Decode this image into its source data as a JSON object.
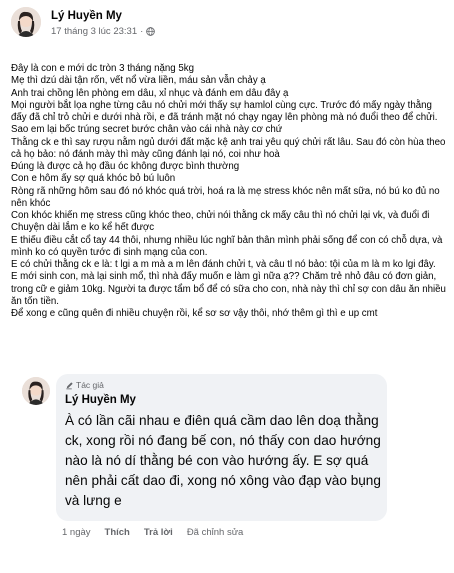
{
  "post": {
    "author": "Lý Huyền My",
    "timestamp": "17 tháng 3 lúc 23:31",
    "separator": "·",
    "privacy_icon": "globe-icon",
    "lines": [
      "Đây là con e mới dc tròn 3 tháng nặng 5kg",
      "Mẹ thì dzú dài tận rốn, vết nổ vừa liền, máu sản vẫn chảy ạ",
      "Anh trai chồng lên phòng em dâu, xỉ nhục và đánh em dâu đây ạ",
      "Mọi người bắt lọa nghe từng câu nó chửi mới thấy sự hamlol cùng cực. Trước đó mấy ngày thằng đấy đã chỉ trỏ chửi e dưới nhà rồi, e đã tránh mặt nó chạy ngay lên phòng mà nó đuổi theo để chửi.",
      "Sao em lại bốc trúng secret bước chân vào cái nhà này cơ chứ",
      "Thằng ck e thì say rượu nằm ngủ dưới đất mặc kệ anh trai yêu quý chửi rất lâu. Sau đó còn hùa theo cả họ bảo: nó đánh mày thì mày cũng đánh lại nó, coi như hoà",
      "Đúng là được cả họ đầu óc không được bình thường",
      "Con e hôm ấy sợ quá khóc bỏ bú luôn",
      "Ròng rã những hôm sau đó nó khóc quá trời, hoá ra là mẹ stress khóc nên mất sữa, nó bú ko đủ no nên khóc",
      "Con khóc khiến mẹ stress cũng khóc theo, chửi nói thằng ck mấy câu thì nó chửi lại vk, và đuổi đi Chuyện dài lắm e ko kể hết được",
      "E thiếu điều cắt cổ tay 44 thôi, nhưng nhiều lúc nghĩ bản thân mình phải sống để con có chỗ dựa, và mình ko có quyền tước đi sinh mạng của con.",
      "E có chửi thằng ck e là: t lgi a m mà a m lên đánh chửi t, và câu tl nó bảo: tội của m là m ko lgi đây.",
      "E mới sinh con, mà lại sinh mổ, thì nhà đấy muốn e làm gì nữa ạ?? Chăm trẻ nhỏ đâu có đơn giản, trong cữ e giảm 10kg. Người ta được tẩm bổ để có sữa cho con, nhà này thì chỉ sợ con dâu ăn nhiều ăn tốn tiền.",
      "Để xong e cũng quên đi nhiều chuyện rồi, kể sơ sơ vậy thôi, nhớ thêm gì thì e up cmt"
    ]
  },
  "comment": {
    "badge": "Tác giả",
    "badge_icon": "pen-icon",
    "author": "Lý Huyền My",
    "text": "À có lần cãi nhau e điên quá cầm dao lên doạ thằng ck, xong rồi nó đang bế con, nó thấy con dao hướng nào là nó dí thằng bé con vào hướng ấy. E sợ quá nên phải cất dao đi, xong nó xông vào đạp vào bụng và lưng e",
    "actions": {
      "time": "1 ngày",
      "like": "Thích",
      "reply": "Trả lời",
      "edited": "Đã chỉnh sửa"
    }
  }
}
